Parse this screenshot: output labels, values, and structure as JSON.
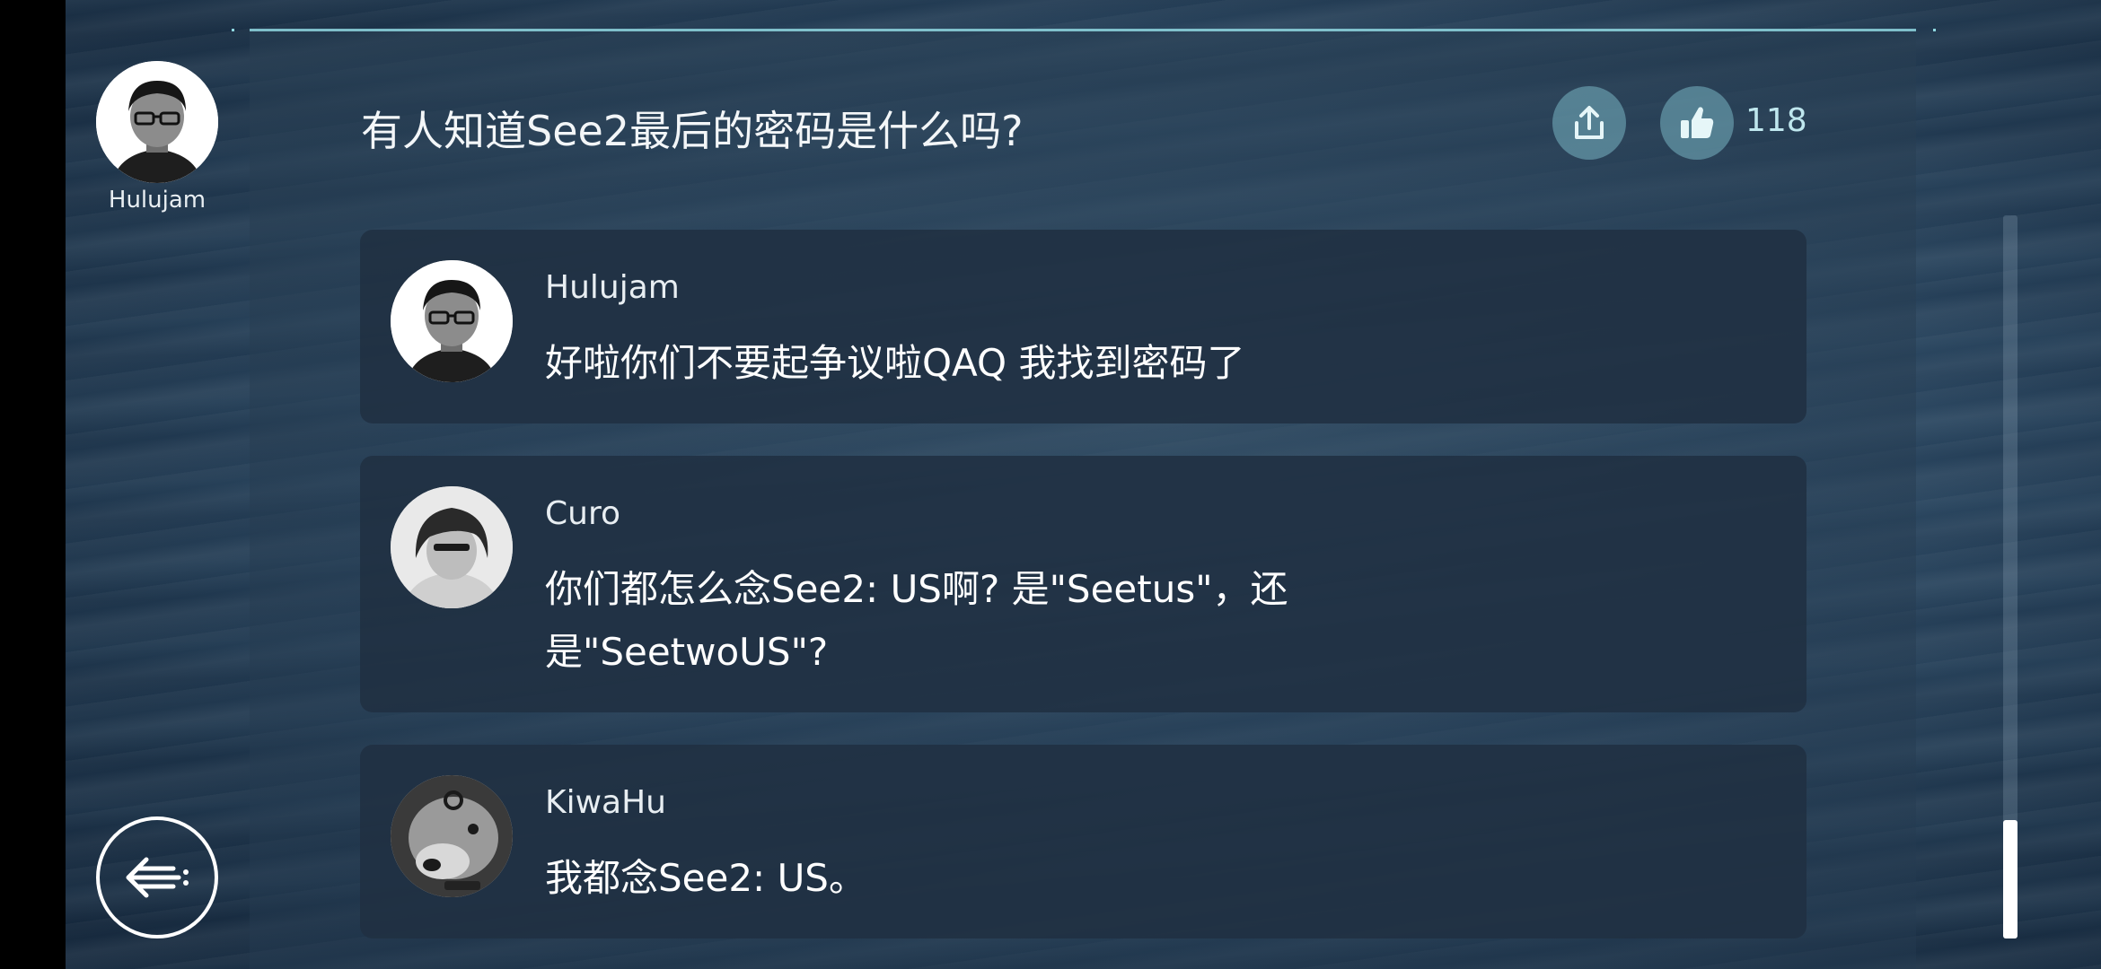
{
  "post": {
    "author": "Hulujam",
    "title": "有人知道See2最后的密码是什么吗?",
    "likes": "118"
  },
  "icons": {
    "share": "share-icon",
    "like": "thumbs-up-icon",
    "back": "back-arrow-icon"
  },
  "comments": [
    {
      "author": "Hulujam",
      "text": "好啦你们不要起争议啦QAQ 我找到密码了"
    },
    {
      "author": "Curo",
      "text": "你们都怎么念See2: US啊? 是\"Seetus\"，还是\"SeetwoUS\"?"
    },
    {
      "author": "KiwaHu",
      "text": "我都念See2: US。"
    }
  ],
  "colors": {
    "accent": "#8fd7e0",
    "card_bg": "#203042",
    "button_bg": "#78b4c3"
  }
}
